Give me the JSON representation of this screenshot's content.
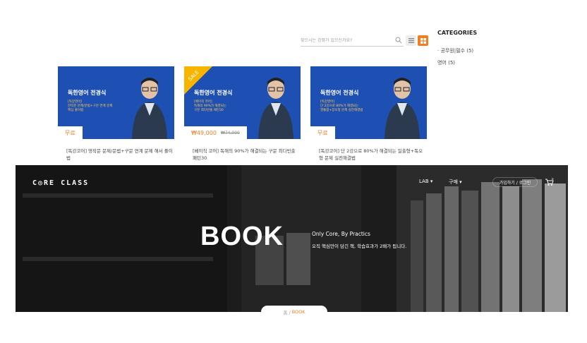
{
  "search": {
    "placeholder": "찾으시는 강좌가 있으신가요?"
  },
  "view_toggle": {
    "list_icon": "list-icon",
    "grid_icon": "grid-icon",
    "active": "grid"
  },
  "categories": {
    "title": "CATEGORIES",
    "items": [
      {
        "label": "· 공무원|필수 (5)"
      },
      {
        "label": "영어 (5)"
      }
    ]
  },
  "products": [
    {
      "thumb_title": "독한영어 전경식",
      "thumb_sub": "[독강영어]\n한작문 문제/문법+구문 연계 문제\n핵심 풀이법",
      "price": "무료",
      "old_price": "",
      "sale": false,
      "desc": "[독강코어] 영작문 문제/문법+구문 연계 문제 해서 풀이법"
    },
    {
      "thumb_title": "독한영어 전경식",
      "thumb_sub": "[베이직 코어]\n독해의 90%가 해결되는\n구문 최다빈출 패턴30",
      "price": "₩49,000",
      "old_price": "₩74,000",
      "sale": true,
      "sale_label": "SALE",
      "desc": "[베이직 코어] 독해의 90%가 해결되는 구문 최다빈출 패턴30"
    },
    {
      "thumb_title": "독한영어 전경식",
      "thumb_sub": "[독강영어]\n단 2강으로 80%가 해결되는\n영통합+장오정 문제 실전해결법",
      "price": "무료",
      "old_price": "",
      "sale": false,
      "desc": "[독강코어] 단 2강으로 80%가 해결되는 일출형+독오형 문제 실전해결법"
    }
  ],
  "header": {
    "logo": "C◎RE CLASS",
    "nav": [
      {
        "label": "LAB ▾"
      },
      {
        "label": "구매 ▾"
      }
    ],
    "login": "가입하기 / 로그인",
    "cart_count": "0"
  },
  "hero": {
    "title": "BOOK",
    "subtitle": "Only Core, By Practics",
    "tagline": "오직 핵심만이 담긴 책, 학습효과가 2배가 됩니다."
  },
  "breadcrumb": {
    "home": "홈 /",
    "current": "BOOK"
  },
  "colors": {
    "accent": "#f07e22",
    "thumb_bg": "#1e4fb3",
    "hero_bg": "#2a2a2a"
  }
}
